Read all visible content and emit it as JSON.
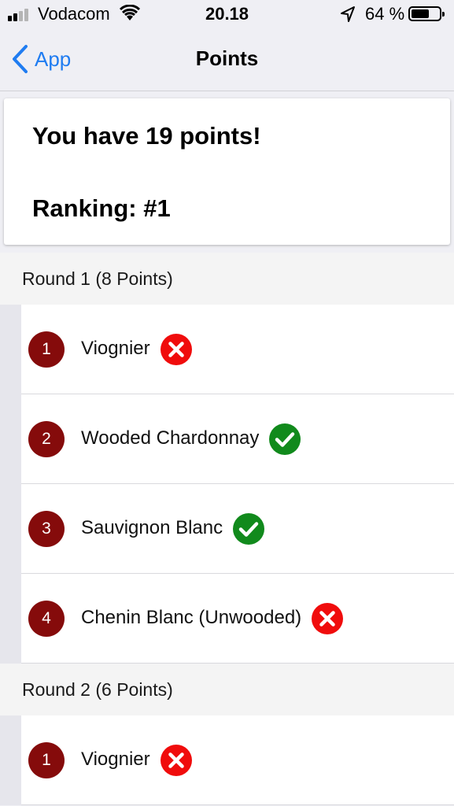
{
  "status_bar": {
    "carrier": "Vodacom",
    "time": "20.18",
    "battery_percent": "64 %",
    "battery_level": 0.64,
    "icons": [
      "signal-icon",
      "wifi-icon",
      "location-arrow-icon",
      "battery-icon"
    ]
  },
  "nav": {
    "back_label": "App",
    "title": "Points"
  },
  "summary": {
    "points_text": "You have 19 points!",
    "ranking_text": "Ranking: #1"
  },
  "rounds": [
    {
      "header": "Round 1 (8 Points)",
      "items": [
        {
          "number": "1",
          "wine": "Viognier",
          "correct": false
        },
        {
          "number": "2",
          "wine": "Wooded Chardonnay",
          "correct": true
        },
        {
          "number": "3",
          "wine": "Sauvignon Blanc",
          "correct": true
        },
        {
          "number": "4",
          "wine": "Chenin Blanc (Unwooded)",
          "correct": false
        }
      ]
    },
    {
      "header": "Round 2 (6 Points)",
      "items": [
        {
          "number": "1",
          "wine": "Viognier",
          "correct": false
        }
      ]
    }
  ],
  "colors": {
    "accent": "#1f7cf1",
    "number_badge": "#850b0b",
    "correct": "#118a1c",
    "incorrect": "#f00c0c"
  }
}
